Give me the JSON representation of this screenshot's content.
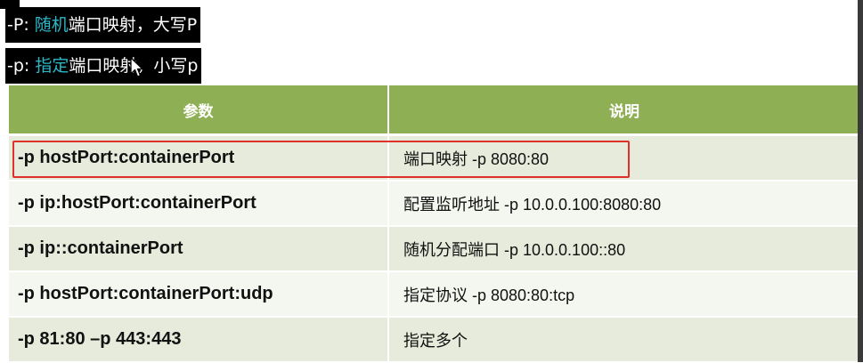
{
  "notes": [
    {
      "prefix": "-P: ",
      "highlight": "随机",
      "suffix": "端口映射，大写P"
    },
    {
      "prefix": "-p: ",
      "highlight": "指定",
      "suffix": "端口映射，小写p"
    }
  ],
  "table": {
    "headers": [
      "参数",
      "说明"
    ],
    "rows": [
      {
        "param": "-p hostPort:containerPort",
        "desc": "端口映射  -p 8080:80"
      },
      {
        "param": "-p ip:hostPort:containerPort",
        "desc": "配置监听地址 -p 10.0.0.100:8080:80"
      },
      {
        "param": "-p ip::containerPort",
        "desc": "随机分配端口 -p 10.0.0.100::80"
      },
      {
        "param": "-p hostPort:containerPort:udp",
        "desc": "指定协议 -p 8080:80:tcp"
      },
      {
        "param": "-p 81:80 –p 443:443",
        "desc": "指定多个"
      }
    ]
  },
  "colors": {
    "header_bg": "#8faf55",
    "highlight_text": "#2cb7c7",
    "annotation_box": "#e0302a"
  }
}
